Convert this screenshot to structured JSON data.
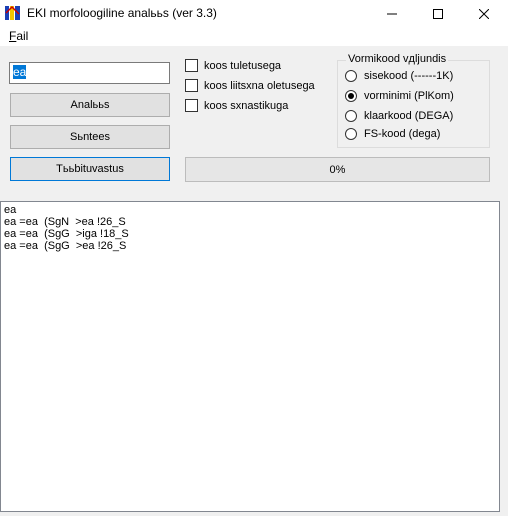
{
  "window": {
    "title": "EKI morfoloogiline analььs (ver 3.3)",
    "icon": "eki-app-icon"
  },
  "menu": {
    "items": [
      {
        "label_accel": "F",
        "label_rest": "ail"
      }
    ]
  },
  "input": {
    "value": "ea"
  },
  "buttons": {
    "analyze": "Analььs",
    "synthesize": "Sьntees",
    "clear": "Tььbituvastus"
  },
  "checkboxes": [
    {
      "label": "koos tuletusega",
      "checked": false
    },
    {
      "label": "koos liitsхna oletusega",
      "checked": false
    },
    {
      "label": "koos sхnastikuga",
      "checked": false
    }
  ],
  "output_form_group": {
    "title": "Vormikood vдljundis",
    "options": [
      {
        "label": "sisekood  (------1K)",
        "selected": false
      },
      {
        "label": "vorminimi  (PlKom)",
        "selected": true
      },
      {
        "label": "klaarkood  (DEGA)",
        "selected": false
      },
      {
        "label": "FS-kood (dega)",
        "selected": false
      }
    ]
  },
  "progress": {
    "text": "0%",
    "value": 0
  },
  "output": {
    "lines": [
      "ea",
      "ea =ea  (SgN  >ea !26_S",
      "ea =ea  (SgG  >iga !18_S",
      "ea =ea  (SgG  >ea !26_S"
    ]
  }
}
